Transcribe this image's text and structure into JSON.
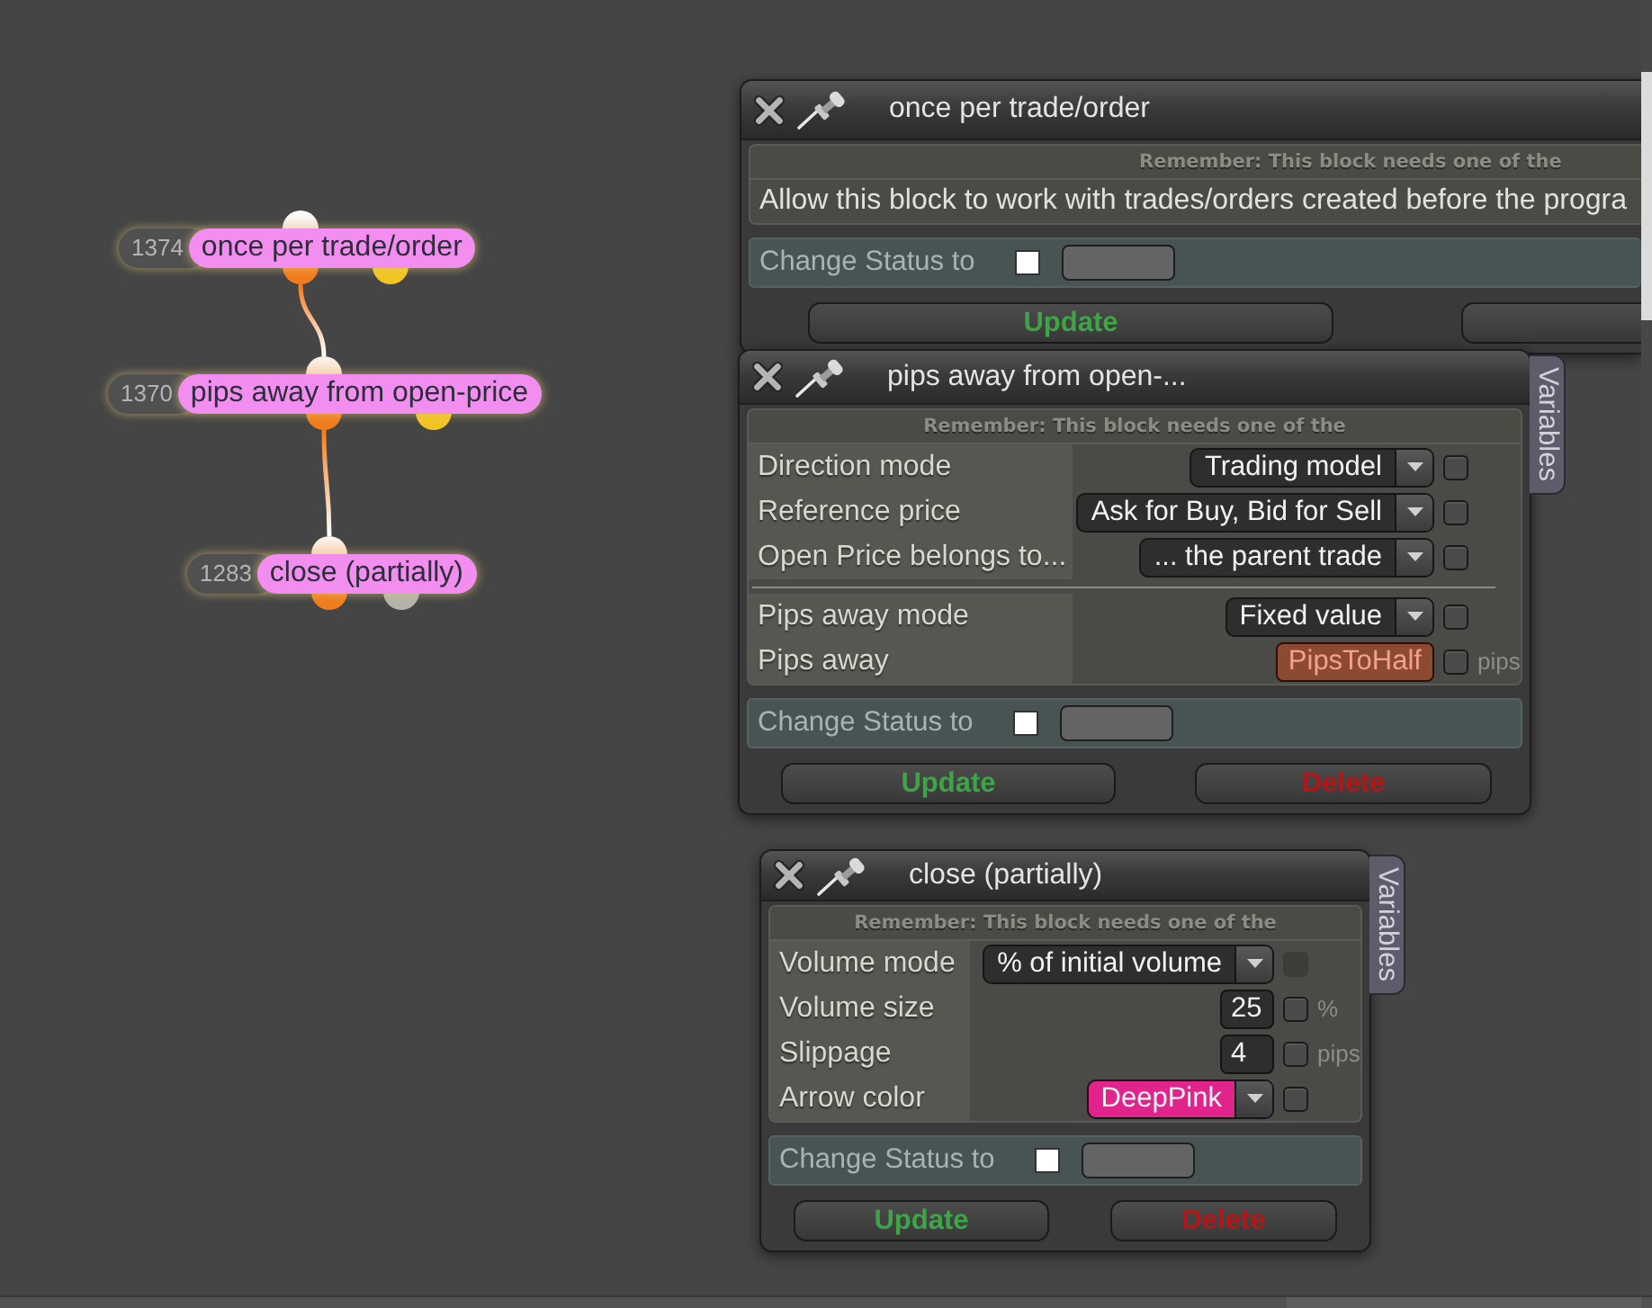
{
  "nodes": [
    {
      "number": "1374",
      "title": "once per trade/order",
      "linked": false,
      "ports": [
        {
          "color": "#f07c1e"
        },
        {
          "color": "#f2c523"
        }
      ]
    },
    {
      "number": "1370",
      "title": "pips away from open-price",
      "linked": true,
      "ports": [
        {
          "color": "#f07c1e"
        },
        {
          "color": "#f2c523"
        }
      ]
    },
    {
      "number": "1283",
      "title": "close (partially)",
      "linked": true,
      "ports": [
        {
          "color": "#f07c1e"
        },
        {
          "color": "#b3b3aa"
        }
      ]
    }
  ],
  "windows": [
    {
      "title": "once per trade/order",
      "notice": "Remember: This block needs one of the",
      "description": "Allow this block to work with trades/orders created before the progra",
      "status": {
        "label": "Change Status to",
        "checked": false
      },
      "buttons": [
        {
          "kind": "update",
          "label": "Update"
        },
        {
          "kind": "plain"
        }
      ]
    },
    {
      "title": "pips away from open-...",
      "variables_tab": "Variables",
      "notice": "Remember: This block needs one of the",
      "row_groups": [
        {
          "rows": [
            {
              "kind": "dropdown",
              "label": "Direction mode",
              "value": "Trading model",
              "checked": false,
              "disabled": false
            },
            {
              "kind": "dropdown",
              "label": "Reference price",
              "value": "Ask for Buy, Bid for Sell",
              "checked": false,
              "disabled": false
            },
            {
              "kind": "dropdown",
              "label": "Open Price belongs to...",
              "value": "... the parent trade",
              "checked": false,
              "disabled": false
            }
          ]
        },
        {
          "rows": [
            {
              "kind": "dropdown",
              "label": "Pips away mode",
              "value": "Fixed value",
              "checked": false,
              "disabled": false
            },
            {
              "kind": "variable",
              "label": "Pips away",
              "value": "PipsToHalf",
              "checked": false,
              "disabled": false,
              "unit": "pips"
            }
          ]
        }
      ],
      "status": {
        "label": "Change Status to",
        "checked": false
      },
      "buttons": [
        {
          "kind": "update",
          "label": "Update"
        },
        {
          "kind": "delete",
          "label": "Delete"
        }
      ]
    },
    {
      "title": "close (partially)",
      "variables_tab": "Variables",
      "notice": "Remember: This block needs one of the",
      "row_groups": [
        {
          "rows": [
            {
              "kind": "dropdown",
              "label": "Volume mode",
              "value": "% of initial volume",
              "checked": false,
              "disabled": true
            },
            {
              "kind": "number",
              "label": "Volume size",
              "value": "25",
              "checked": false,
              "disabled": false,
              "unit": "%"
            },
            {
              "kind": "number",
              "label": "Slippage",
              "value": "4",
              "checked": false,
              "disabled": false,
              "unit": "pips"
            },
            {
              "kind": "color",
              "label": "Arrow color",
              "value": "DeepPink",
              "color": "#e0248c",
              "checked": false,
              "disabled": false
            }
          ]
        }
      ],
      "status": {
        "label": "Change Status to",
        "checked": false
      },
      "buttons": [
        {
          "kind": "update",
          "label": "Update"
        },
        {
          "kind": "delete",
          "label": "Delete"
        }
      ]
    }
  ]
}
